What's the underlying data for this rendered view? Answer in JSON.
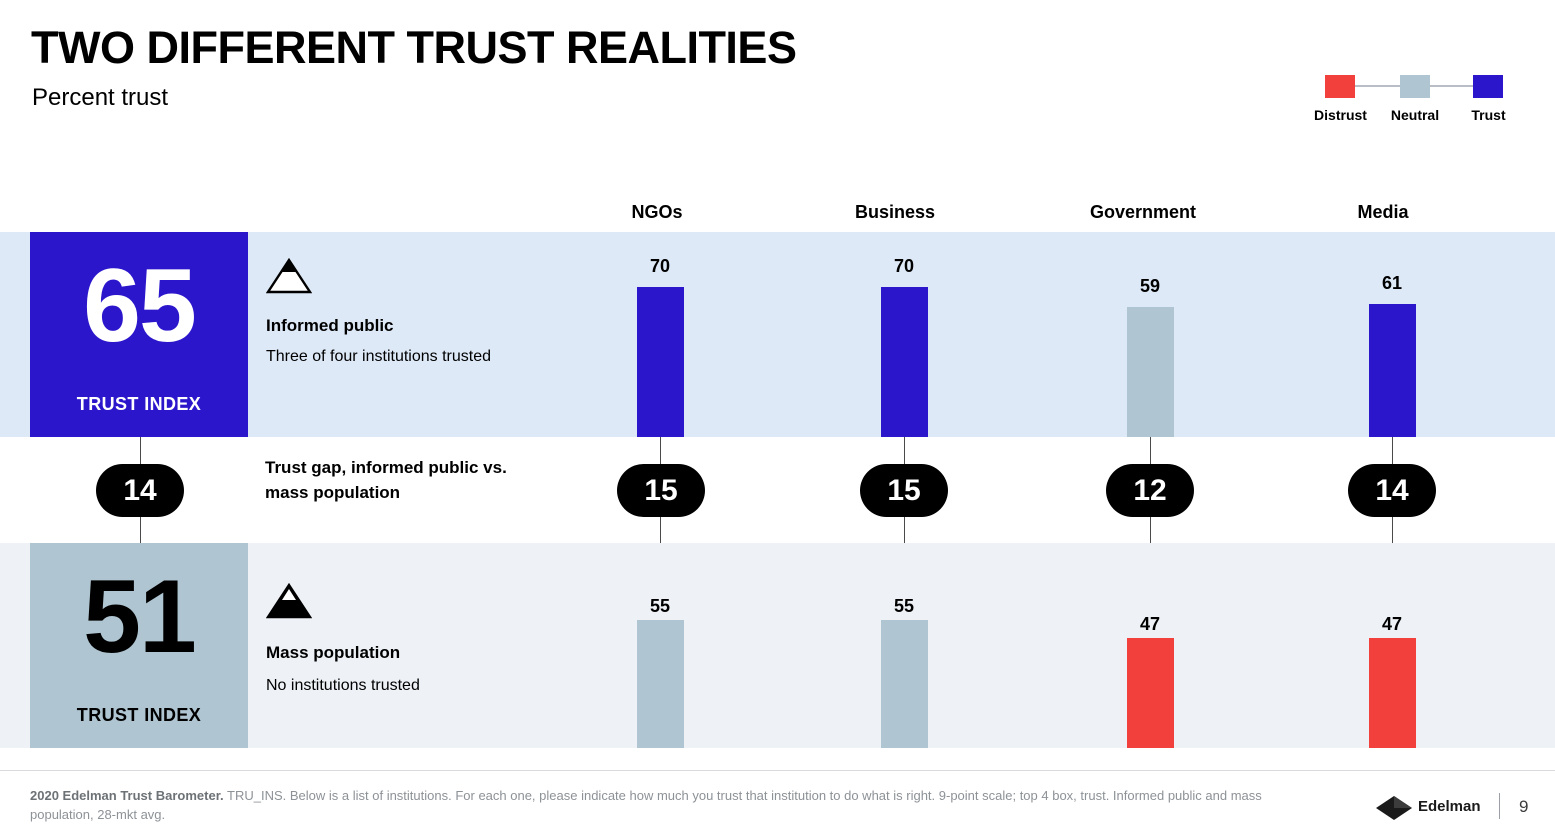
{
  "header": {
    "title": "TWO DIFFERENT TRUST REALITIES",
    "subtitle": "Percent trust"
  },
  "legend": {
    "items": [
      {
        "label": "Distrust",
        "color": "#f2413c"
      },
      {
        "label": "Neutral",
        "color": "#afc6d2"
      },
      {
        "label": "Trust",
        "color": "#2b16cc"
      }
    ]
  },
  "segments": {
    "informed": {
      "index_value": "65",
      "index_caption": "TRUST INDEX",
      "name": "Informed public",
      "note": "Three of four institutions trusted",
      "icon": "triangle-top-filled-icon"
    },
    "mass": {
      "index_value": "51",
      "index_caption": "TRUST INDEX",
      "name": "Mass population",
      "note": "No institutions trusted",
      "icon": "triangle-mostly-filled-icon"
    }
  },
  "gap": {
    "label": "Trust gap, informed public vs. mass population",
    "index_gap": "14"
  },
  "footer": {
    "note_bold": "2020 Edelman Trust Barometer.",
    "note_rest": " TRU_INS. Below is a list of institutions. For each one, please indicate how much you trust that institution to do what is right. 9-point scale; top 4 box, trust. Informed public and mass population, 28-mkt avg.",
    "brand": "Edelman",
    "page": "9"
  },
  "chart_data": {
    "type": "bar",
    "title": "TWO DIFFERENT TRUST REALITIES",
    "subtitle": "Percent trust",
    "ylabel": "Percent trust",
    "xlabel": "",
    "ylim": [
      0,
      100
    ],
    "grid": false,
    "legend_position": "top-right",
    "categories": [
      "NGOs",
      "Business",
      "Government",
      "Media"
    ],
    "series": [
      {
        "name": "Informed public",
        "values": [
          70,
          70,
          59,
          61
        ],
        "colors": [
          "#2b16cc",
          "#2b16cc",
          "#afc6d2",
          "#2b16cc"
        ],
        "states": [
          "Trust",
          "Trust",
          "Neutral",
          "Trust"
        ],
        "index": 65
      },
      {
        "name": "Mass population",
        "values": [
          55,
          55,
          47,
          47
        ],
        "colors": [
          "#afc6d2",
          "#afc6d2",
          "#f2413c",
          "#f2413c"
        ],
        "states": [
          "Neutral",
          "Neutral",
          "Distrust",
          "Distrust"
        ],
        "index": 51
      }
    ],
    "gaps": {
      "index": 14,
      "by_category": [
        15,
        15,
        12,
        14
      ]
    },
    "annotations": [
      "Informed public — Three of four institutions trusted",
      "Mass population — No institutions trusted",
      "Trust gap, informed public vs. mass population"
    ]
  }
}
